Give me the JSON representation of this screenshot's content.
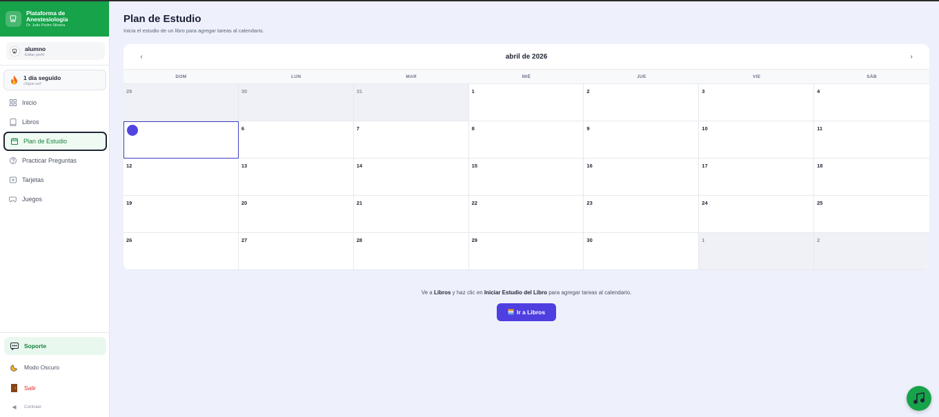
{
  "brand": {
    "title": "Plataforma de Anestesiología",
    "subtitle": "Dr. João Pedro Silveira"
  },
  "profile": {
    "name": "alumno",
    "edit": "Editar perfil"
  },
  "streak": {
    "title": "1 día seguido",
    "subtitle": "¡Sigue así!"
  },
  "nav": {
    "items": [
      {
        "label": "Inicio",
        "icon": "grid-icon"
      },
      {
        "label": "Libros",
        "icon": "book-icon"
      },
      {
        "label": "Plan de Estudio",
        "icon": "calendar-icon",
        "active": true
      },
      {
        "label": "Practicar Preguntas",
        "icon": "help-circle-icon"
      },
      {
        "label": "Tarjetas",
        "icon": "card-plus-icon"
      },
      {
        "label": "Juegos",
        "icon": "gamepad-icon"
      }
    ]
  },
  "bottom": {
    "support": "Soporte",
    "dark_mode": "Modo Oscuro",
    "logout": "Salir",
    "collapse": "Contraer"
  },
  "page": {
    "title": "Plan de Estudio",
    "subtitle": "Inicia el estudio de un libro para agregar tareas al calendario."
  },
  "calendar": {
    "month": "abril de 2026",
    "prev": "‹",
    "next": "›",
    "weekdays": [
      "DOM",
      "LUN",
      "MAR",
      "MIÉ",
      "JUE",
      "VIE",
      "SÁB"
    ],
    "days": [
      {
        "n": "29",
        "other": true
      },
      {
        "n": "30",
        "other": true
      },
      {
        "n": "31",
        "other": true
      },
      {
        "n": "1"
      },
      {
        "n": "2"
      },
      {
        "n": "3"
      },
      {
        "n": "4"
      },
      {
        "n": "5",
        "today": true
      },
      {
        "n": "6"
      },
      {
        "n": "7"
      },
      {
        "n": "8"
      },
      {
        "n": "9"
      },
      {
        "n": "10"
      },
      {
        "n": "11"
      },
      {
        "n": "12"
      },
      {
        "n": "13"
      },
      {
        "n": "14"
      },
      {
        "n": "15"
      },
      {
        "n": "16"
      },
      {
        "n": "17"
      },
      {
        "n": "18"
      },
      {
        "n": "19"
      },
      {
        "n": "20"
      },
      {
        "n": "21"
      },
      {
        "n": "22"
      },
      {
        "n": "23"
      },
      {
        "n": "24"
      },
      {
        "n": "25"
      },
      {
        "n": "26"
      },
      {
        "n": "27"
      },
      {
        "n": "28"
      },
      {
        "n": "29"
      },
      {
        "n": "30"
      },
      {
        "n": "1",
        "other": true
      },
      {
        "n": "2",
        "other": true
      }
    ]
  },
  "hint": {
    "p1": "Ve a ",
    "b1": "Libros",
    "p2": " y haz clic en ",
    "b2": "Iniciar Estudio del Libro",
    "p3": " para agregar tareas al calendario."
  },
  "cta": {
    "label": "Ir a Libros"
  },
  "colors": {
    "brand_green": "#16a34a",
    "accent_purple": "#4f3fe0",
    "logout_red": "#dc2626"
  }
}
